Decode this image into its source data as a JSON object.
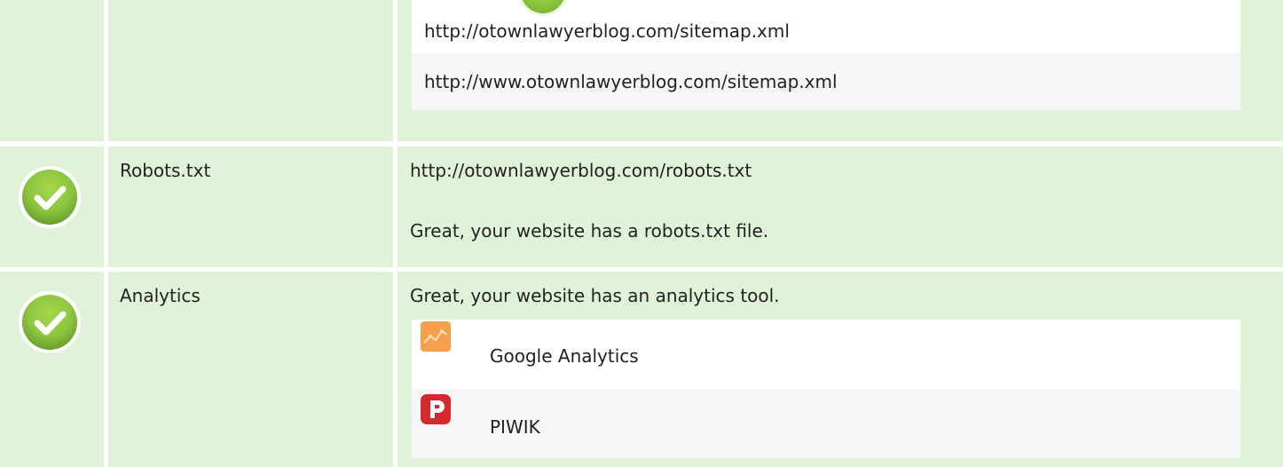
{
  "sitemap": {
    "urls": [
      "http://otownlawyerblog.com/sitemap.xml",
      "http://www.otownlawyerblog.com/sitemap.xml"
    ]
  },
  "robots": {
    "label": "Robots.txt",
    "url": "http://otownlawyerblog.com/robots.txt",
    "message": "Great, your website has a robots.txt file.",
    "status_icon": "check-circle-icon"
  },
  "analytics": {
    "label": "Analytics",
    "message": "Great, your website has an analytics tool.",
    "status_icon": "check-circle-icon",
    "tools": [
      {
        "name": "Google Analytics",
        "icon": "google-analytics-icon"
      },
      {
        "name": "PIWIK",
        "icon": "piwik-icon"
      }
    ]
  },
  "colors": {
    "row_background": "#e0f2d8",
    "check_green": "#8dc63f",
    "google_orange": "#f7a04b",
    "piwik_red": "#d7282f"
  }
}
